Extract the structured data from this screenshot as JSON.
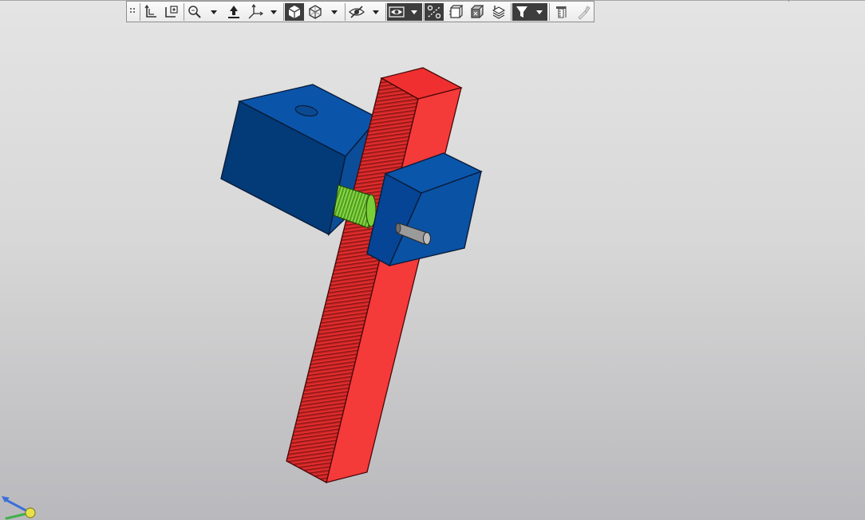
{
  "toolbar": {
    "items": [
      {
        "icon": "grip-icon",
        "active": false
      },
      {
        "icon": "sketch-icon",
        "active": false
      },
      {
        "icon": "sketch-plane-icon",
        "active": false
      },
      {
        "icon": "zoom-icon",
        "active": false
      },
      {
        "icon": "chevron-down-icon",
        "active": false
      },
      {
        "icon": "orient-icon",
        "active": false
      },
      {
        "icon": "axis-triad-icon",
        "active": false
      },
      {
        "icon": "chevron-down-icon",
        "active": false
      },
      {
        "icon": "shaded-cube-icon",
        "active": true
      },
      {
        "icon": "wireframe-cube-icon",
        "active": false
      },
      {
        "icon": "chevron-down-icon",
        "active": false
      },
      {
        "icon": "hide-eye-icon",
        "active": false
      },
      {
        "icon": "chevron-down-icon",
        "active": false
      },
      {
        "icon": "show-eye-icon",
        "active": true
      },
      {
        "icon": "chevron-down-icon",
        "active": true
      },
      {
        "icon": "section-icon",
        "active": true
      },
      {
        "icon": "perspective-icon",
        "active": false
      },
      {
        "icon": "display-mode-icon",
        "active": false
      },
      {
        "icon": "layers-icon",
        "active": false
      },
      {
        "icon": "filter-icon",
        "active": true
      },
      {
        "icon": "chevron-down-icon",
        "active": true
      },
      {
        "icon": "measure-icon",
        "active": false
      },
      {
        "icon": "pipette-icon",
        "active": false
      }
    ]
  },
  "model": {
    "parts": [
      "rack",
      "left-housing",
      "right-housing",
      "pinion-gear",
      "shaft"
    ],
    "colors": {
      "rack": "#f53a3a",
      "housing": "#0b55a8",
      "pinion": "#7fd63a",
      "shaft": "#8e8e8e"
    }
  },
  "triad": {
    "icon": "axis-triad-icon"
  }
}
